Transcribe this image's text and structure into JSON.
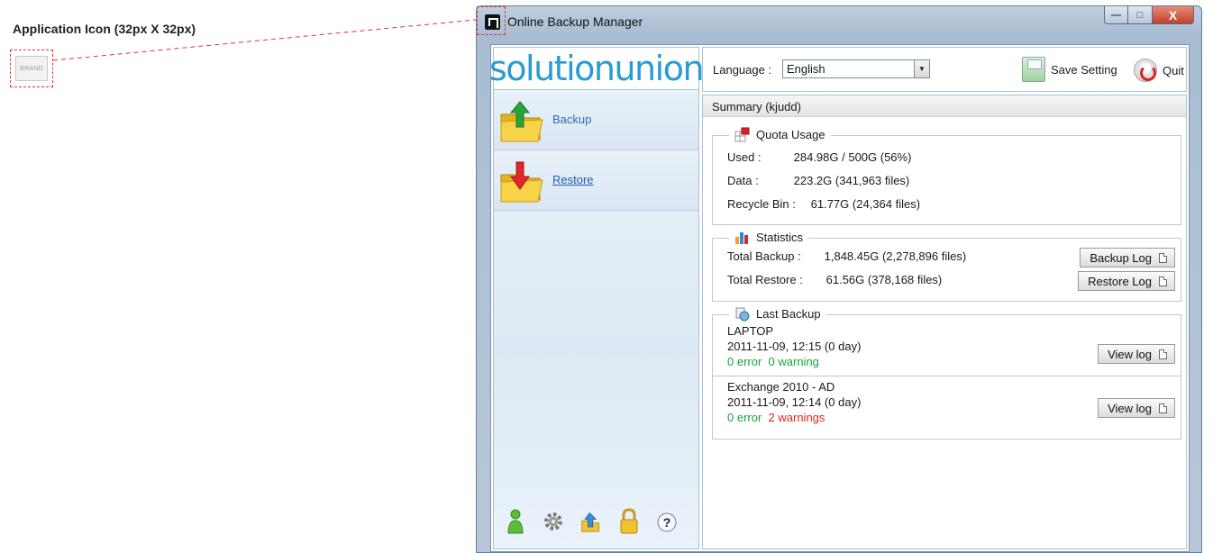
{
  "annotation": {
    "title": "Application Icon (32px X 32px)",
    "brand_text": "BRAND"
  },
  "window": {
    "title": "Online Backup Manager",
    "close_symbol": "X",
    "minimize_symbol": "—",
    "maximize_symbol": "□"
  },
  "sidebar": {
    "logo": "solutionunion",
    "items": [
      {
        "label": "Backup",
        "icon": "folder-upload-icon"
      },
      {
        "label": "Restore",
        "icon": "folder-download-icon"
      }
    ],
    "footer_icons": [
      "user-icon",
      "gear-icon",
      "upload-icon",
      "lock-icon",
      "help-icon"
    ],
    "help_symbol": "?"
  },
  "topbar": {
    "language_label": "Language :",
    "language_value": "English",
    "save_label": "Save Setting",
    "quit_label": "Quit"
  },
  "summary": {
    "header": "Summary (kjudd)",
    "quota": {
      "title": "Quota Usage",
      "used_label": "Used :",
      "used_value": "284.98G / 500G (56%)",
      "data_label": "Data :",
      "data_value": "223.2G  (341,963 files)",
      "recycle_label": "Recycle Bin :",
      "recycle_value": "61.77G  (24,364 files)"
    },
    "statistics": {
      "title": "Statistics",
      "total_backup_label": "Total Backup :",
      "total_backup_value": "1,848.45G  (2,278,896 files)",
      "total_restore_label": "Total Restore :",
      "total_restore_value": "61.56G  (378,168 files)",
      "backup_log_label": "Backup Log",
      "restore_log_label": "Restore Log"
    },
    "last_backup": {
      "title": "Last Backup",
      "entries": [
        {
          "name": "LAPTOP",
          "time": "2011-11-09, 12:15 (0 day)",
          "errors": "0 error",
          "warnings": "0 warning",
          "view_label": "View log"
        },
        {
          "name": "Exchange 2010 - AD",
          "time": "2011-11-09, 12:14 (0 day)",
          "errors": "0 error",
          "warnings": "2 warnings",
          "view_label": "View log"
        }
      ]
    }
  },
  "colors": {
    "accent_blue": "#2b9bd3",
    "ok_green": "#1aa33a",
    "warn_red": "#e32222"
  }
}
